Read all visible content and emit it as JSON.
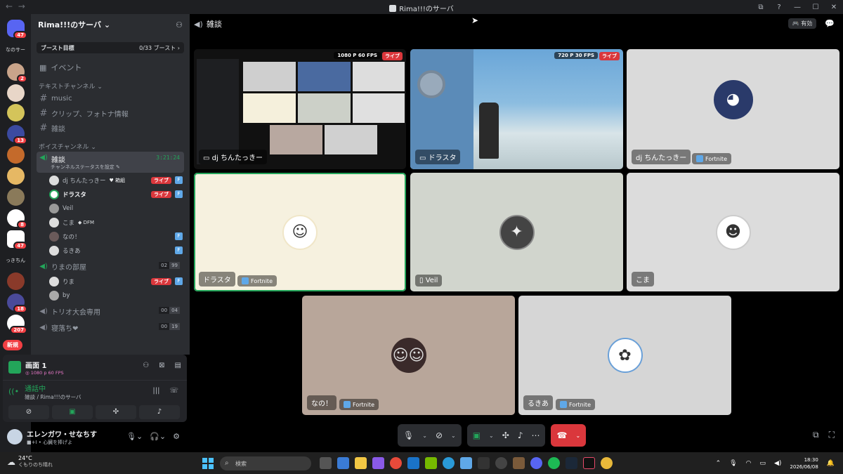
{
  "window": {
    "title": "Rima!!!のサーバ",
    "nav_back": "←",
    "nav_forward": "→",
    "controls": [
      "⧉",
      "?",
      "—",
      "☐",
      "✕"
    ]
  },
  "servers": {
    "home_badge": "47",
    "folder_label": "なのサー",
    "label_2": "っきちん",
    "badges": [
      "2",
      "13",
      "8",
      "47",
      "18",
      "207"
    ],
    "new_label": "新規"
  },
  "guild": {
    "name": "Rima!!!のサーバ",
    "chevron": "⌄",
    "boost_goal": "ブースト目標",
    "boost_count": "0/33 ブースト ›",
    "events": "イベント",
    "text_category": "テキストチャンネル ⌄",
    "text_channels": [
      "music",
      "クリップ、フォトナ情報",
      "雑談"
    ],
    "voice_category": "ボイスチャンネル ⌄",
    "active_voice": {
      "name": "雑談",
      "timer": "3:21:24",
      "status": "チャンネルステータスを設定 ✎"
    },
    "voice_users": [
      {
        "name": "dj ちんたっきー",
        "tag": "♥ 箱組",
        "live": "ライブ",
        "fn": "F"
      },
      {
        "name": "ドラスタ",
        "tag": "",
        "live": "ライブ",
        "fn": "F"
      },
      {
        "name": "Veil",
        "tag": "",
        "live": "",
        "fn": ""
      },
      {
        "name": "こま",
        "tag": "◆ DFM",
        "live": "",
        "fn": ""
      },
      {
        "name": "なの！",
        "tag": "",
        "live": "",
        "fn": "F"
      },
      {
        "name": "るきあ",
        "tag": "",
        "live": "",
        "fn": "F"
      }
    ],
    "room2": {
      "name": "りまの部屋",
      "c1": "02",
      "c2": "99"
    },
    "room2_users": [
      {
        "name": "りま",
        "live": "ライブ",
        "fn": "F"
      },
      {
        "name": "by",
        "live": "",
        "fn": ""
      }
    ],
    "room3": {
      "name": "トリオ大会専用",
      "c1": "00",
      "c2": "04"
    },
    "room4": {
      "name": "寝落ち❤",
      "c1": "00",
      "c2": "19"
    }
  },
  "panel": {
    "screen_title": "画面 1",
    "screen_quality": "◎ 1080 p 60 FPS",
    "call_status": "通話中",
    "call_location": "雑談 / Rima!!!のサーバ"
  },
  "user": {
    "name": "エレンガワ・せなちす",
    "status": "■+I • 心臓を捧げよ"
  },
  "call": {
    "channel": "雑談",
    "activity_label": "🎮 有効"
  },
  "tiles": [
    {
      "name": "dj ちんたっきー",
      "quality": "1080 P 60 FPS",
      "live": "ライブ"
    },
    {
      "name": "ドラスタ",
      "quality": "720 P 30 FPS",
      "live": "ライブ"
    },
    {
      "name": "dj ちんたっきー",
      "activity": "Fortnite"
    },
    {
      "name": "ドラスタ",
      "activity": "Fortnite"
    },
    {
      "name": "Veil"
    },
    {
      "name": "こま"
    },
    {
      "name": "なの！",
      "activity": "Fortnite"
    },
    {
      "name": "るきあ",
      "activity": "Fortnite"
    }
  ],
  "taskbar": {
    "temp": "24°C",
    "weather": "くもりのち晴れ",
    "search": "検索",
    "time": "18:30",
    "date": "2026/06/08"
  },
  "colors": {
    "accent_green": "#23a55a",
    "live_red": "#da373c",
    "sidebar_bg": "#2b2d31",
    "server_bg": "#1e1f22"
  }
}
